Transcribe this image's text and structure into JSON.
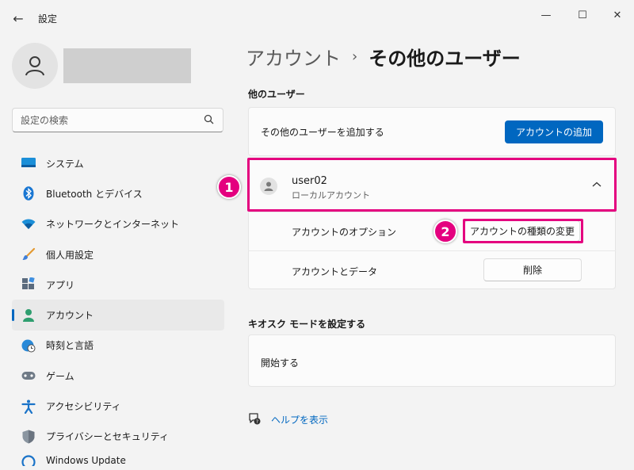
{
  "window": {
    "app_title": "設定",
    "back_glyph": "←",
    "minimize_glyph": "—",
    "maximize_glyph": "☐",
    "close_glyph": "✕"
  },
  "sidebar": {
    "search_placeholder": "設定の検索",
    "items": [
      {
        "label": "システム",
        "icon": "monitor-icon"
      },
      {
        "label": "Bluetooth とデバイス",
        "icon": "bluetooth-icon"
      },
      {
        "label": "ネットワークとインターネット",
        "icon": "wifi-icon"
      },
      {
        "label": "個人用設定",
        "icon": "brush-icon"
      },
      {
        "label": "アプリ",
        "icon": "apps-icon"
      },
      {
        "label": "アカウント",
        "icon": "person-icon",
        "active": true
      },
      {
        "label": "時刻と言語",
        "icon": "globe-clock-icon"
      },
      {
        "label": "ゲーム",
        "icon": "gamepad-icon"
      },
      {
        "label": "アクセシビリティ",
        "icon": "accessibility-icon"
      },
      {
        "label": "プライバシーとセキュリティ",
        "icon": "shield-icon"
      },
      {
        "label": "Windows Update",
        "icon": "update-icon"
      }
    ]
  },
  "main": {
    "breadcrumb_parent": "アカウント",
    "breadcrumb_sep": "›",
    "breadcrumb_current": "その他のユーザー",
    "other_users_heading": "他のユーザー",
    "add_user_text": "その他のユーザーを追加する",
    "add_account_button": "アカウントの追加",
    "user": {
      "name": "user02",
      "type": "ローカルアカウント"
    },
    "account_options_label": "アカウントのオプション",
    "change_type_button": "アカウントの種類の変更",
    "account_data_label": "アカウントとデータ",
    "delete_button": "削除",
    "kiosk_heading": "キオスク モードを設定する",
    "kiosk_start": "開始する",
    "help_link": "ヘルプを表示"
  },
  "annotations": {
    "badge1": "1",
    "badge2": "2",
    "accent_color": "#e4007f"
  }
}
